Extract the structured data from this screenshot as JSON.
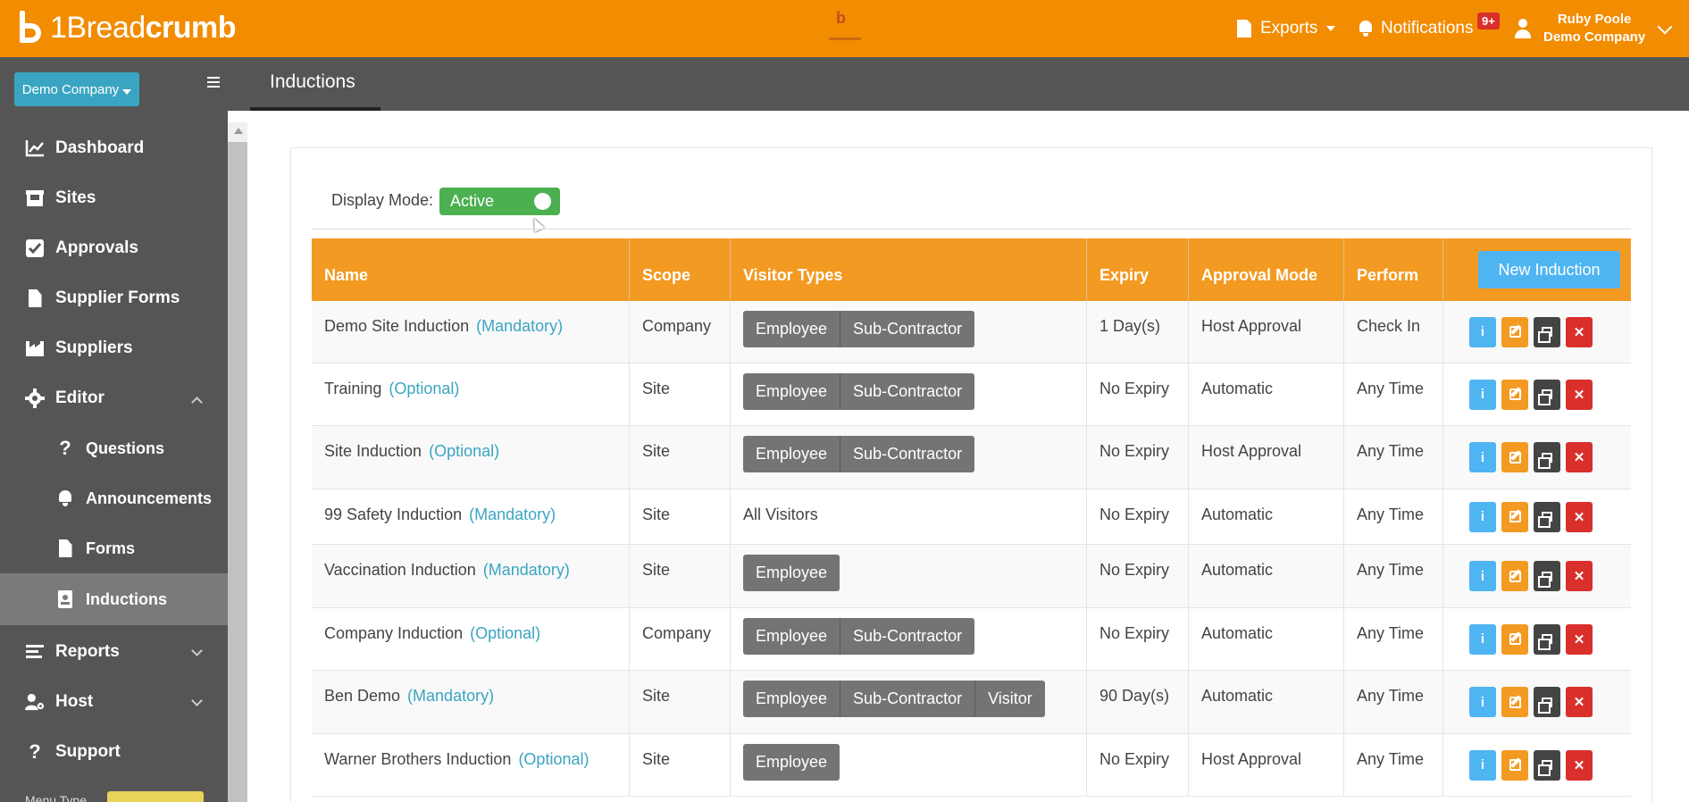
{
  "brand": {
    "name_light": "1Bread",
    "name_bold": "crumb",
    "accent": "#f28c00"
  },
  "topnav": {
    "exports_label": "Exports",
    "notifications_label": "Notifications",
    "notifications_badge": "9+",
    "user_name": "Ruby Poole",
    "user_company": "Demo Company"
  },
  "sidebar": {
    "company_selector": "Demo Company",
    "items": [
      {
        "label": "Dashboard",
        "icon": "chart-line-icon"
      },
      {
        "label": "Sites",
        "icon": "store-icon"
      },
      {
        "label": "Approvals",
        "icon": "check-square-icon"
      },
      {
        "label": "Supplier Forms",
        "icon": "file-icon"
      },
      {
        "label": "Suppliers",
        "icon": "industry-icon"
      },
      {
        "label": "Editor",
        "icon": "gear-icon",
        "expanded": true
      },
      {
        "label": "Questions",
        "icon": "question-icon"
      },
      {
        "label": "Announcements",
        "icon": "bell-icon"
      },
      {
        "label": "Forms",
        "icon": "file-icon"
      },
      {
        "label": "Inductions",
        "icon": "id-badge-icon",
        "active": true
      },
      {
        "label": "Reports",
        "icon": "list-icon"
      },
      {
        "label": "Host",
        "icon": "user-gear-icon"
      },
      {
        "label": "Support",
        "icon": "question-icon"
      }
    ],
    "menu_type_label": "Menu Type"
  },
  "page": {
    "tab": "Inductions",
    "display_mode_label": "Display Mode:",
    "display_mode_value": "Active",
    "new_button": "New Induction"
  },
  "table": {
    "headers": [
      "Name",
      "Scope",
      "Visitor Types",
      "Expiry",
      "Approval Mode",
      "Perform"
    ],
    "rows": [
      {
        "name": "Demo Site Induction",
        "tag": "(Mandatory)",
        "scope": "Company",
        "visitor_types": [
          "Employee",
          "Sub-Contractor"
        ],
        "expiry": "1 Day(s)",
        "approval": "Host Approval",
        "perform": "Check In"
      },
      {
        "name": "Training",
        "tag": "(Optional)",
        "scope": "Site",
        "visitor_types": [
          "Employee",
          "Sub-Contractor"
        ],
        "expiry": "No Expiry",
        "approval": "Automatic",
        "perform": "Any Time"
      },
      {
        "name": "Site Induction",
        "tag": "(Optional)",
        "scope": "Site",
        "visitor_types": [
          "Employee",
          "Sub-Contractor"
        ],
        "expiry": "No Expiry",
        "approval": "Host Approval",
        "perform": "Any Time"
      },
      {
        "name": "99 Safety Induction",
        "tag": "(Mandatory)",
        "scope": "Site",
        "visitor_text": "All Visitors",
        "visitor_types": [],
        "expiry": "No Expiry",
        "approval": "Automatic",
        "perform": "Any Time"
      },
      {
        "name": "Vaccination Induction",
        "tag": "(Mandatory)",
        "scope": "Site",
        "visitor_types": [
          "Employee"
        ],
        "expiry": "No Expiry",
        "approval": "Automatic",
        "perform": "Any Time"
      },
      {
        "name": "Company Induction",
        "tag": "(Optional)",
        "scope": "Company",
        "visitor_types": [
          "Employee",
          "Sub-Contractor"
        ],
        "expiry": "No Expiry",
        "approval": "Automatic",
        "perform": "Any Time"
      },
      {
        "name": "Ben Demo",
        "tag": "(Mandatory)",
        "scope": "Site",
        "visitor_types": [
          "Employee",
          "Sub-Contractor",
          "Visitor"
        ],
        "expiry": "90 Day(s)",
        "approval": "Automatic",
        "perform": "Any Time"
      },
      {
        "name": "Warner Brothers Induction",
        "tag": "(Optional)",
        "scope": "Site",
        "visitor_types": [
          "Employee"
        ],
        "expiry": "No Expiry",
        "approval": "Host Approval",
        "perform": "Any Time"
      }
    ]
  }
}
